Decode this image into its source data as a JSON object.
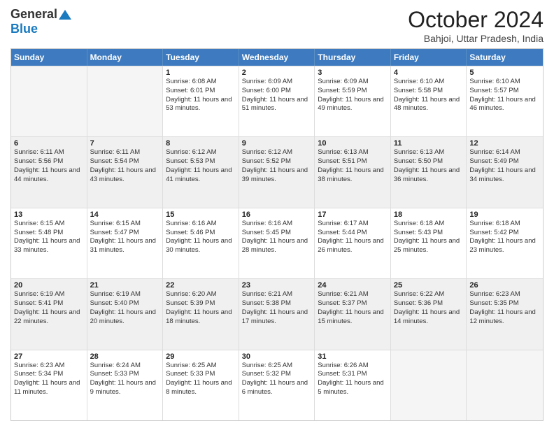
{
  "logo": {
    "line1": "General",
    "line2": "Blue"
  },
  "header": {
    "month": "October 2024",
    "location": "Bahjoi, Uttar Pradesh, India"
  },
  "days_of_week": [
    "Sunday",
    "Monday",
    "Tuesday",
    "Wednesday",
    "Thursday",
    "Friday",
    "Saturday"
  ],
  "weeks": [
    [
      {
        "day": "",
        "sunrise": "",
        "sunset": "",
        "daylight": "",
        "empty": true
      },
      {
        "day": "",
        "sunrise": "",
        "sunset": "",
        "daylight": "",
        "empty": true
      },
      {
        "day": "1",
        "sunrise": "Sunrise: 6:08 AM",
        "sunset": "Sunset: 6:01 PM",
        "daylight": "Daylight: 11 hours and 53 minutes.",
        "empty": false
      },
      {
        "day": "2",
        "sunrise": "Sunrise: 6:09 AM",
        "sunset": "Sunset: 6:00 PM",
        "daylight": "Daylight: 11 hours and 51 minutes.",
        "empty": false
      },
      {
        "day": "3",
        "sunrise": "Sunrise: 6:09 AM",
        "sunset": "Sunset: 5:59 PM",
        "daylight": "Daylight: 11 hours and 49 minutes.",
        "empty": false
      },
      {
        "day": "4",
        "sunrise": "Sunrise: 6:10 AM",
        "sunset": "Sunset: 5:58 PM",
        "daylight": "Daylight: 11 hours and 48 minutes.",
        "empty": false
      },
      {
        "day": "5",
        "sunrise": "Sunrise: 6:10 AM",
        "sunset": "Sunset: 5:57 PM",
        "daylight": "Daylight: 11 hours and 46 minutes.",
        "empty": false
      }
    ],
    [
      {
        "day": "6",
        "sunrise": "Sunrise: 6:11 AM",
        "sunset": "Sunset: 5:56 PM",
        "daylight": "Daylight: 11 hours and 44 minutes.",
        "empty": false
      },
      {
        "day": "7",
        "sunrise": "Sunrise: 6:11 AM",
        "sunset": "Sunset: 5:54 PM",
        "daylight": "Daylight: 11 hours and 43 minutes.",
        "empty": false
      },
      {
        "day": "8",
        "sunrise": "Sunrise: 6:12 AM",
        "sunset": "Sunset: 5:53 PM",
        "daylight": "Daylight: 11 hours and 41 minutes.",
        "empty": false
      },
      {
        "day": "9",
        "sunrise": "Sunrise: 6:12 AM",
        "sunset": "Sunset: 5:52 PM",
        "daylight": "Daylight: 11 hours and 39 minutes.",
        "empty": false
      },
      {
        "day": "10",
        "sunrise": "Sunrise: 6:13 AM",
        "sunset": "Sunset: 5:51 PM",
        "daylight": "Daylight: 11 hours and 38 minutes.",
        "empty": false
      },
      {
        "day": "11",
        "sunrise": "Sunrise: 6:13 AM",
        "sunset": "Sunset: 5:50 PM",
        "daylight": "Daylight: 11 hours and 36 minutes.",
        "empty": false
      },
      {
        "day": "12",
        "sunrise": "Sunrise: 6:14 AM",
        "sunset": "Sunset: 5:49 PM",
        "daylight": "Daylight: 11 hours and 34 minutes.",
        "empty": false
      }
    ],
    [
      {
        "day": "13",
        "sunrise": "Sunrise: 6:15 AM",
        "sunset": "Sunset: 5:48 PM",
        "daylight": "Daylight: 11 hours and 33 minutes.",
        "empty": false
      },
      {
        "day": "14",
        "sunrise": "Sunrise: 6:15 AM",
        "sunset": "Sunset: 5:47 PM",
        "daylight": "Daylight: 11 hours and 31 minutes.",
        "empty": false
      },
      {
        "day": "15",
        "sunrise": "Sunrise: 6:16 AM",
        "sunset": "Sunset: 5:46 PM",
        "daylight": "Daylight: 11 hours and 30 minutes.",
        "empty": false
      },
      {
        "day": "16",
        "sunrise": "Sunrise: 6:16 AM",
        "sunset": "Sunset: 5:45 PM",
        "daylight": "Daylight: 11 hours and 28 minutes.",
        "empty": false
      },
      {
        "day": "17",
        "sunrise": "Sunrise: 6:17 AM",
        "sunset": "Sunset: 5:44 PM",
        "daylight": "Daylight: 11 hours and 26 minutes.",
        "empty": false
      },
      {
        "day": "18",
        "sunrise": "Sunrise: 6:18 AM",
        "sunset": "Sunset: 5:43 PM",
        "daylight": "Daylight: 11 hours and 25 minutes.",
        "empty": false
      },
      {
        "day": "19",
        "sunrise": "Sunrise: 6:18 AM",
        "sunset": "Sunset: 5:42 PM",
        "daylight": "Daylight: 11 hours and 23 minutes.",
        "empty": false
      }
    ],
    [
      {
        "day": "20",
        "sunrise": "Sunrise: 6:19 AM",
        "sunset": "Sunset: 5:41 PM",
        "daylight": "Daylight: 11 hours and 22 minutes.",
        "empty": false
      },
      {
        "day": "21",
        "sunrise": "Sunrise: 6:19 AM",
        "sunset": "Sunset: 5:40 PM",
        "daylight": "Daylight: 11 hours and 20 minutes.",
        "empty": false
      },
      {
        "day": "22",
        "sunrise": "Sunrise: 6:20 AM",
        "sunset": "Sunset: 5:39 PM",
        "daylight": "Daylight: 11 hours and 18 minutes.",
        "empty": false
      },
      {
        "day": "23",
        "sunrise": "Sunrise: 6:21 AM",
        "sunset": "Sunset: 5:38 PM",
        "daylight": "Daylight: 11 hours and 17 minutes.",
        "empty": false
      },
      {
        "day": "24",
        "sunrise": "Sunrise: 6:21 AM",
        "sunset": "Sunset: 5:37 PM",
        "daylight": "Daylight: 11 hours and 15 minutes.",
        "empty": false
      },
      {
        "day": "25",
        "sunrise": "Sunrise: 6:22 AM",
        "sunset": "Sunset: 5:36 PM",
        "daylight": "Daylight: 11 hours and 14 minutes.",
        "empty": false
      },
      {
        "day": "26",
        "sunrise": "Sunrise: 6:23 AM",
        "sunset": "Sunset: 5:35 PM",
        "daylight": "Daylight: 11 hours and 12 minutes.",
        "empty": false
      }
    ],
    [
      {
        "day": "27",
        "sunrise": "Sunrise: 6:23 AM",
        "sunset": "Sunset: 5:34 PM",
        "daylight": "Daylight: 11 hours and 11 minutes.",
        "empty": false
      },
      {
        "day": "28",
        "sunrise": "Sunrise: 6:24 AM",
        "sunset": "Sunset: 5:33 PM",
        "daylight": "Daylight: 11 hours and 9 minutes.",
        "empty": false
      },
      {
        "day": "29",
        "sunrise": "Sunrise: 6:25 AM",
        "sunset": "Sunset: 5:33 PM",
        "daylight": "Daylight: 11 hours and 8 minutes.",
        "empty": false
      },
      {
        "day": "30",
        "sunrise": "Sunrise: 6:25 AM",
        "sunset": "Sunset: 5:32 PM",
        "daylight": "Daylight: 11 hours and 6 minutes.",
        "empty": false
      },
      {
        "day": "31",
        "sunrise": "Sunrise: 6:26 AM",
        "sunset": "Sunset: 5:31 PM",
        "daylight": "Daylight: 11 hours and 5 minutes.",
        "empty": false
      },
      {
        "day": "",
        "sunrise": "",
        "sunset": "",
        "daylight": "",
        "empty": true
      },
      {
        "day": "",
        "sunrise": "",
        "sunset": "",
        "daylight": "",
        "empty": true
      }
    ]
  ]
}
